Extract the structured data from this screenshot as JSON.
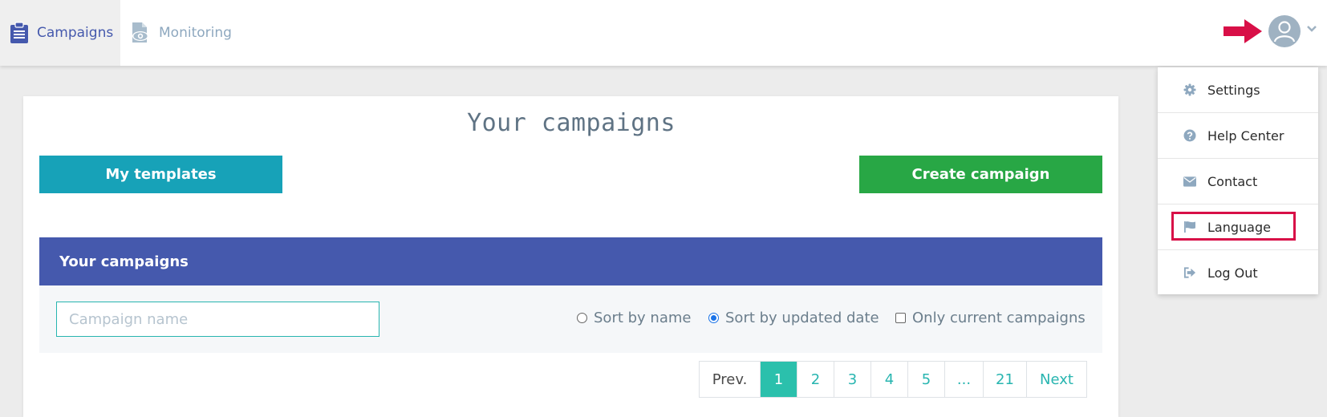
{
  "nav": {
    "tabs": [
      {
        "label": "Campaigns",
        "icon": "clipboard-icon",
        "active": true
      },
      {
        "label": "Monitoring",
        "icon": "document-eye-icon",
        "active": false
      }
    ]
  },
  "header": {
    "avatar_icon": "user-avatar-icon",
    "chevron_icon": "chevron-down-icon",
    "arrow_icon": "arrow-right-icon",
    "arrow_color": "#d80f47"
  },
  "main": {
    "title": "Your campaigns",
    "templates_button": "My templates",
    "create_button": "Create campaign",
    "panel_title": "Your campaigns",
    "search": {
      "placeholder": "Campaign name",
      "value": ""
    },
    "sort_options": [
      {
        "label": "Sort by name",
        "type": "radio",
        "checked": false
      },
      {
        "label": "Sort by updated date",
        "type": "radio",
        "checked": true
      },
      {
        "label": "Only current campaigns",
        "type": "checkbox",
        "checked": false
      }
    ],
    "pagination": {
      "prev": "Prev.",
      "pages": [
        "1",
        "2",
        "3",
        "4",
        "5",
        "...",
        "21"
      ],
      "current": "1",
      "next": "Next"
    }
  },
  "dropdown": {
    "items": [
      {
        "label": "Settings",
        "icon": "gear-icon"
      },
      {
        "label": "Help Center",
        "icon": "question-circle-icon"
      },
      {
        "label": "Contact",
        "icon": "envelope-icon"
      },
      {
        "label": "Language",
        "icon": "flag-icon",
        "highlighted": true
      },
      {
        "label": "Log Out",
        "icon": "logout-icon"
      }
    ]
  },
  "colors": {
    "primary": "#4559ad",
    "info": "#17a2b8",
    "success": "#28a745",
    "teal": "#2bc0ac",
    "highlight": "#d80f47"
  }
}
